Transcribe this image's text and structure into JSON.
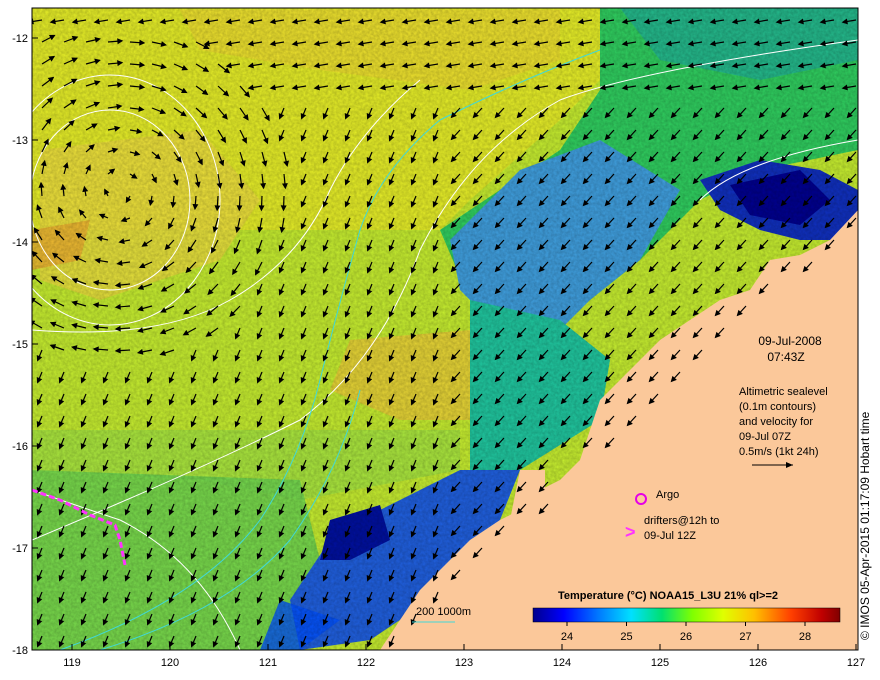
{
  "map": {
    "date": "09-Jul-2008",
    "time": "07:43Z",
    "altimetry_lines": [
      "Altimetric sealevel",
      "(0.1m contours)",
      "and velocity for",
      "09-Jul 07Z",
      "0.5m/s (1kt 24h)"
    ],
    "argo_label": "Argo",
    "drifter_lines": [
      "drifters@12h to",
      "09-Jul 12Z"
    ],
    "drifter_symbol": ">",
    "depth_label": "200  1000m",
    "colorbar_title": "Temperature (°C) NOAA15_L3U 21% ql>=2",
    "colorbar_ticks": [
      "24",
      "25",
      "26",
      "27",
      "28"
    ],
    "credit": "© IMOS 05-Apr-2015 01:17:09 Hobart time",
    "lon_ticks": [
      "119",
      "120",
      "121",
      "122",
      "123",
      "124",
      "125",
      "126",
      "127"
    ],
    "lat_ticks": [
      "-12",
      "-13",
      "-14",
      "-15",
      "-16",
      "-17",
      "-18"
    ],
    "colors": {
      "land": "#fbc89a",
      "argo": "#e600e6",
      "drifter": "#ff33ff",
      "contour": "#ffffff",
      "isobath": "#40d8d8",
      "arrow": "#000000",
      "colorbar": [
        "#00008c",
        "#0000ff",
        "#0080ff",
        "#00ffff",
        "#00ff80",
        "#80ff00",
        "#ffff00",
        "#ff8000",
        "#ff0000",
        "#800000"
      ]
    }
  }
}
